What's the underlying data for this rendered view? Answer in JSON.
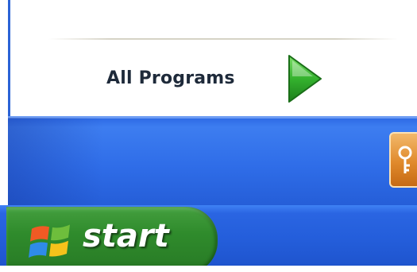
{
  "start_menu": {
    "all_programs_label": "All Programs",
    "all_programs_arrow_icon": "green-right-arrow-icon",
    "logoff_icon": "key-icon"
  },
  "taskbar": {
    "start_label": "start",
    "start_icon": "windows-flag-icon"
  },
  "colors": {
    "taskbar_blue": "#245edb",
    "start_green": "#2f8b2c",
    "menu_footer_blue": "#2f6de8",
    "arrow_green": "#2fa72c"
  }
}
